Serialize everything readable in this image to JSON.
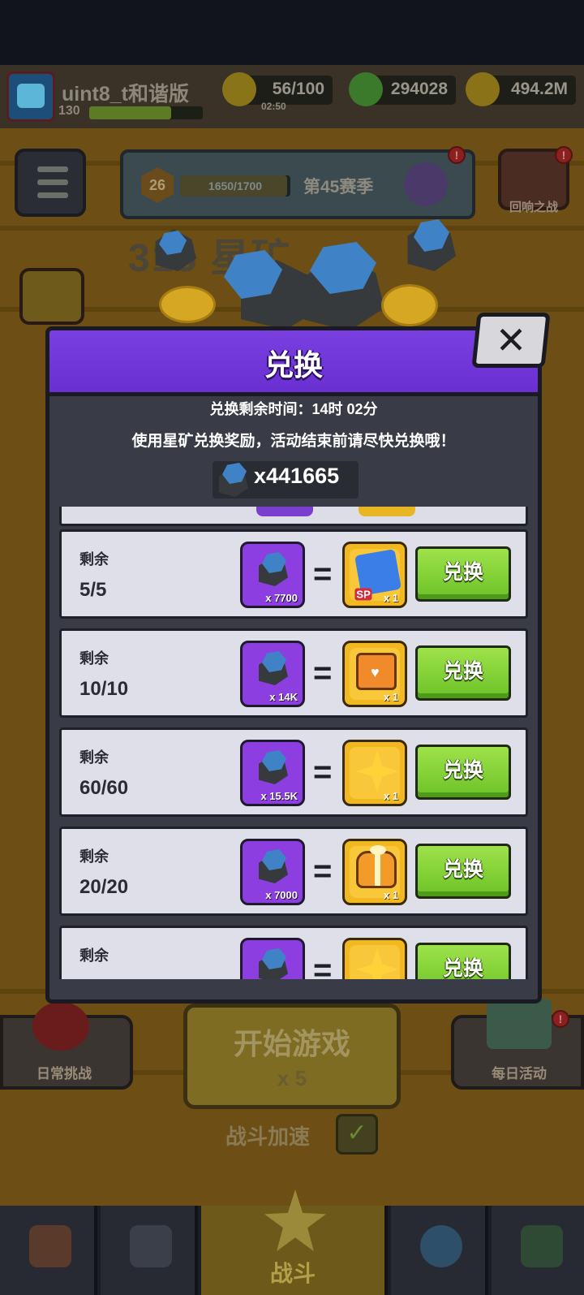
{
  "hud": {
    "username": "uint8_t和谐版",
    "level": "130",
    "energy": "56/100",
    "energy_timer": "02:50",
    "gems": "294028",
    "gold": "494.2M"
  },
  "season": {
    "level": "26",
    "progress": "1650/1700",
    "name": "第45赛季"
  },
  "side_buttons": {
    "echo_battle": "回响之战",
    "alert": "!"
  },
  "background_title": "315 星矿",
  "bottom": {
    "daily_challenge": "日常挑战",
    "start_game": "开始游戏",
    "start_cost": "x 5",
    "daily_event": "每日活动",
    "battle_speed": "战斗加速",
    "nav_battle": "战斗"
  },
  "modal": {
    "title": "兑换",
    "close": "✕",
    "timer_text": "兑换剩余时间：14时 02分",
    "description": "使用星矿兑换奖励，活动结束前请尽快兑换哦！",
    "balance": "x441665",
    "remaining_label": "剩余",
    "button_label": "兑换",
    "items": [
      {
        "remaining": "5/5",
        "cost": "x 7700",
        "reward_icon": "sp-puzzle-icon",
        "reward_amount": "x 1",
        "reward_badge": "SP"
      },
      {
        "remaining": "10/10",
        "cost": "x 14K",
        "reward_icon": "heart-chest-icon",
        "reward_amount": "x 1"
      },
      {
        "remaining": "60/60",
        "cost": "x 15.5K",
        "reward_icon": "star-icon",
        "reward_amount": "x 1"
      },
      {
        "remaining": "20/20",
        "cost": "x 7000",
        "reward_icon": "heart-gift-icon",
        "reward_amount": "x 1"
      },
      {
        "remaining": "",
        "cost": "",
        "reward_icon": "star-chest-icon",
        "reward_amount": ""
      }
    ]
  },
  "colors": {
    "header_purple": "#7a3fe0",
    "button_green": "#7cc92f",
    "reward_gold": "#f1b822",
    "cost_purple": "#8c3ee0",
    "row_bg": "#dedfe8"
  }
}
